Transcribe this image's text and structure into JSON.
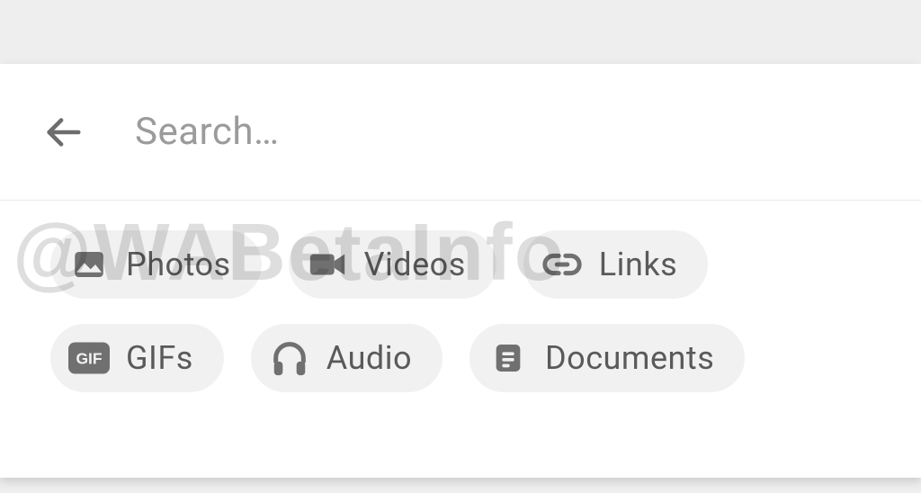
{
  "search": {
    "placeholder": "Search…"
  },
  "chips": {
    "photos": "Photos",
    "videos": "Videos",
    "links": "Links",
    "gifs": "GIFs",
    "audio": "Audio",
    "documents": "Documents"
  },
  "watermark": "@WABetaInfo"
}
